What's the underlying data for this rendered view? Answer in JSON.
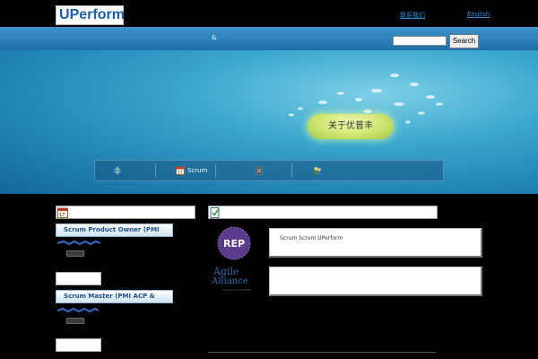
{
  "header": {
    "logo_text_u": "U",
    "logo_text_rest": "Perform",
    "links": [
      "联系我们",
      "English"
    ]
  },
  "nav": {
    "amp": "&",
    "search_placeholder": "",
    "search_label": "Search"
  },
  "hero": {
    "about_label": "关于优普丰"
  },
  "submenu": {
    "items": [
      {
        "icon": "globe-icon",
        "label": ""
      },
      {
        "icon": "calendar-icon",
        "label": "Scrum"
      },
      {
        "icon": "trash-icon",
        "label": ""
      },
      {
        "icon": "people-icon",
        "label": ""
      }
    ]
  },
  "left": {
    "course1_label": "Scrum Product Owner        (PMI",
    "course2_label": "Scrum Master        (PMI ACP &"
  },
  "right": {
    "panel1_text": "Scrum   Scrum                UPerform",
    "rep_badge": "REP",
    "agile_badge_line1": "Agile",
    "agile_badge_line2": "Alliance",
    "agile_badge_line3": "CORPORATE MEMBER"
  },
  "colors": {
    "brand_blue": "#1a5fa8",
    "nav_blue": "#2a7fbd",
    "accent_green": "#c9e26a",
    "rep_purple": "#5b3c8c"
  }
}
